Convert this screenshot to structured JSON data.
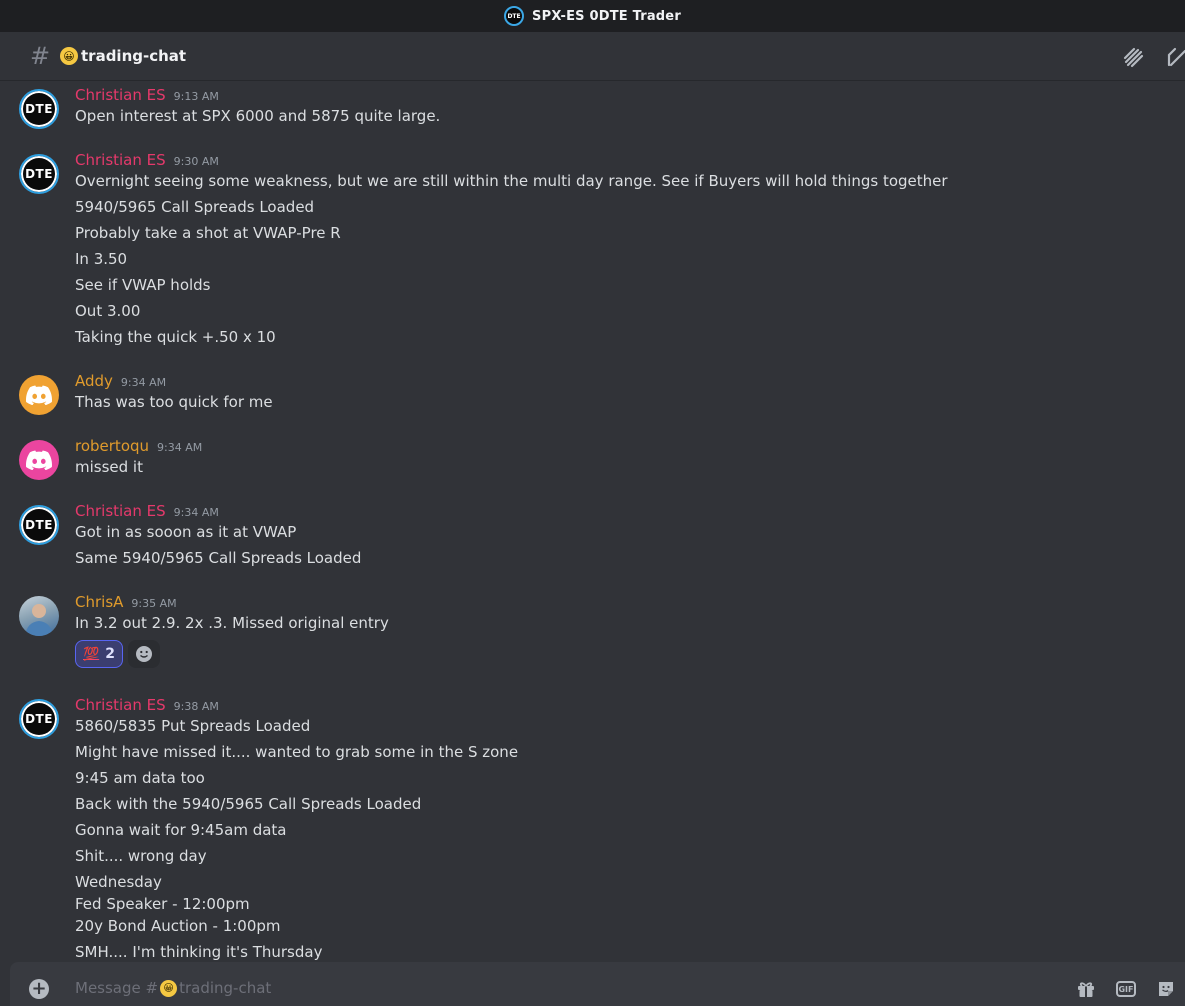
{
  "app": {
    "title": "SPX-ES 0DTE Trader",
    "logo_text": "DTE"
  },
  "channel": {
    "name": "trading-chat",
    "emoji": "😀"
  },
  "colors": {
    "christian": "#e5396b",
    "gold": "#e09b2c",
    "bg": "#313338"
  },
  "messages": [
    {
      "user": "Christian ES",
      "time": "9:13 AM",
      "avatar": "dte",
      "lines": [
        "Open interest at SPX 6000 and 5875 quite large."
      ]
    },
    {
      "user": "Christian ES",
      "time": "9:30 AM",
      "avatar": "dte",
      "lines": [
        "Overnight seeing some weakness, but we are still within the multi day range. See if Buyers will hold things together",
        "5940/5965 Call Spreads Loaded",
        "Probably take a shot at VWAP-Pre R",
        "In 3.50",
        "See if VWAP holds",
        "Out 3.00",
        "Taking the quick +.50 x 10"
      ]
    },
    {
      "user": "Addy",
      "time": "9:34 AM",
      "avatar": "discord-orange",
      "lines": [
        "Thas was too quick for me"
      ]
    },
    {
      "user": "robertoqu",
      "time": "9:34 AM",
      "avatar": "discord-pink",
      "lines": [
        "missed it"
      ]
    },
    {
      "user": "Christian ES",
      "time": "9:34 AM",
      "avatar": "dte",
      "lines": [
        "Got in as sooon as it at VWAP",
        "Same 5940/5965 Call Spreads Loaded"
      ]
    },
    {
      "user": "ChrisA",
      "time": "9:35 AM",
      "avatar": "photo",
      "lines": [
        "In 3.2 out 2.9. 2x .3.  Missed original entry"
      ],
      "reaction": {
        "emoji": "💯",
        "count": "2"
      }
    },
    {
      "user": "Christian ES",
      "time": "9:38 AM",
      "avatar": "dte",
      "lines": [
        "5860/5835 Put Spreads Loaded",
        "Might have missed it.... wanted to grab some in the S zone",
        "9:45 am data too",
        "Back with the 5940/5965 Call Spreads Loaded",
        "Gonna wait for 9:45am data",
        "Shit.... wrong day",
        "Wednesday",
        "Fed Speaker - 12:00pm",
        "20y Bond Auction - 1:00pm",
        "SMH.... I'm thinking it's Thursday"
      ]
    }
  ],
  "composer": {
    "placeholder_prefix": "Message #",
    "placeholder_channel": "trading-chat",
    "gif_label": "GIF"
  }
}
